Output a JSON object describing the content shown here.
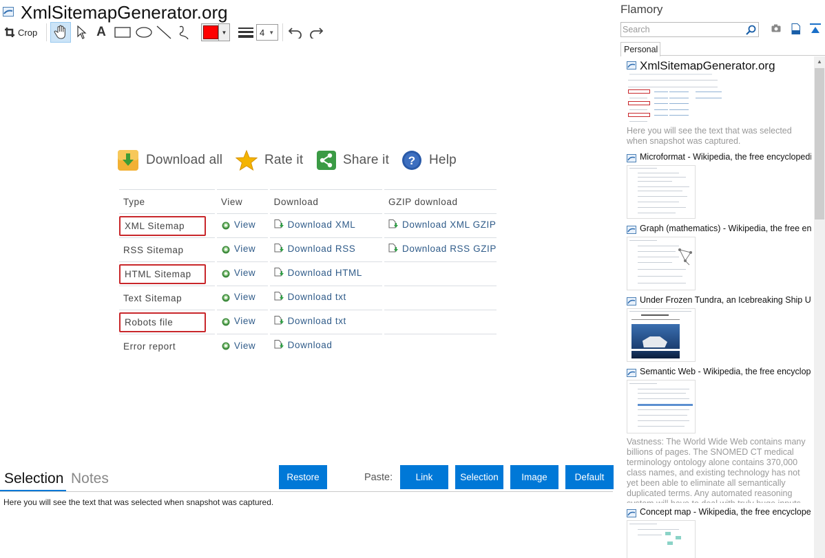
{
  "window": {
    "title": "XmlSitemapGenerator.org"
  },
  "toolbar": {
    "crop_label": "Crop",
    "text_tool": "A",
    "line_width": "4",
    "color": "#ff0000"
  },
  "snapshot": {
    "actions": [
      {
        "label": "Download all",
        "icon": "download-icon"
      },
      {
        "label": "Rate it",
        "icon": "star-icon"
      },
      {
        "label": "Share it",
        "icon": "share-icon"
      },
      {
        "label": "Help",
        "icon": "help-icon"
      }
    ],
    "table": {
      "headers": {
        "type": "Type",
        "view": "View",
        "download": "Download",
        "gzip": "GZIP download"
      },
      "rows": [
        {
          "type": "XML Sitemap",
          "highlighted": true,
          "view": "View",
          "download": "Download XML",
          "gzip": "Download XML GZIP"
        },
        {
          "type": "RSS Sitemap",
          "highlighted": false,
          "view": "View",
          "download": "Download RSS",
          "gzip": "Download RSS GZIP"
        },
        {
          "type": "HTML Sitemap",
          "highlighted": true,
          "view": "View",
          "download": "Download HTML",
          "gzip": ""
        },
        {
          "type": "Text Sitemap",
          "highlighted": false,
          "view": "View",
          "download": "Download txt",
          "gzip": ""
        },
        {
          "type": "Robots file",
          "highlighted": true,
          "view": "View",
          "download": "Download txt",
          "gzip": ""
        },
        {
          "type": "Error report",
          "highlighted": false,
          "view": "View",
          "download": "Download",
          "gzip": ""
        }
      ],
      "highlight_color": "#c8262a"
    }
  },
  "bottom": {
    "tabs": {
      "selection": "Selection",
      "notes": "Notes"
    },
    "restore_label": "Restore",
    "paste_label": "Paste:",
    "paste_buttons": {
      "link": "Link",
      "selection": "Selection",
      "image": "Image",
      "default": "Default"
    },
    "selection_text": "Here you will see the text that was selected when snapshot was captured.",
    "accent": "#0078d7"
  },
  "panel": {
    "title": "Flamory",
    "search_placeholder": "Search",
    "tab": "Personal",
    "items": [
      {
        "title": "XmlSitemapGenerator.org",
        "text": "Here you will see the text that was selected when snapshot was captured."
      },
      {
        "title": "Microformat - Wikipedia, the free encyclopedia",
        "text": ""
      },
      {
        "title": "Graph (mathematics) - Wikipedia, the free encyclopedia",
        "text": ""
      },
      {
        "title": "Under Frozen Tundra, an Icebreaking Ship Uncovers",
        "text": ""
      },
      {
        "title": "Semantic Web - Wikipedia, the free encyclopedia",
        "text": "Vastness: The World Wide Web contains many billions of pages. The SNOMED CT medical terminology ontology alone contains 370,000 class names, and existing technology has not yet been able to eliminate all semantically duplicated terms. Any automated reasoning system will have to deal with truly huge inputs."
      },
      {
        "title": "Concept map - Wikipedia, the free encyclopedia",
        "text": ""
      }
    ]
  }
}
